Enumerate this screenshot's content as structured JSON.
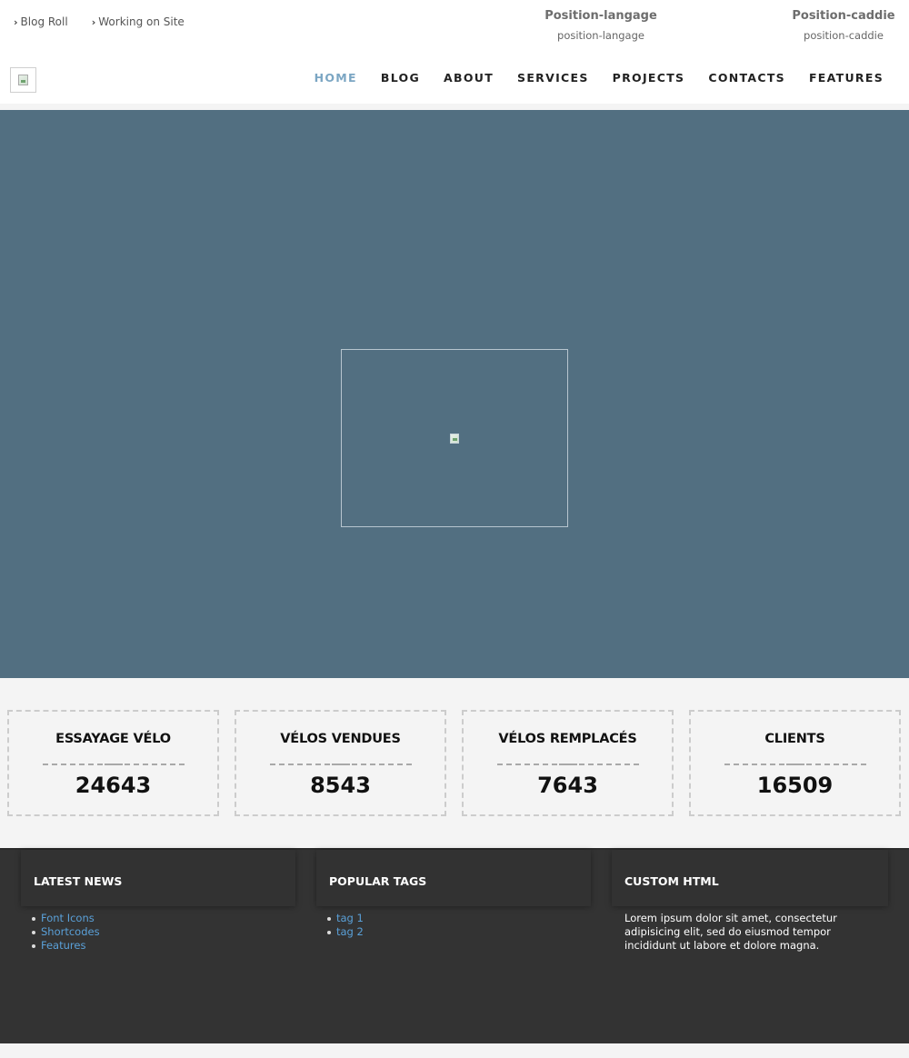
{
  "top_links": [
    {
      "label": "Blog Roll"
    },
    {
      "label": "Working on Site"
    }
  ],
  "position_langage": {
    "title": "Position-langage",
    "subtitle": "position-langage"
  },
  "position_caddie": {
    "title": "Position-caddie",
    "subtitle": "position-caddie"
  },
  "nav": {
    "items": [
      {
        "label": "HOME"
      },
      {
        "label": "BLOG"
      },
      {
        "label": "ABOUT"
      },
      {
        "label": "SERVICES"
      },
      {
        "label": "PROJECTS"
      },
      {
        "label": "CONTACTS"
      },
      {
        "label": "FEATURES"
      }
    ],
    "active_index": 0,
    "active_color": "#7ba6c3"
  },
  "hero": {
    "background_color": "#526f81"
  },
  "counters": [
    {
      "title": "ESSAYAGE VÉLO",
      "value": "24643"
    },
    {
      "title": "VÉLOS VENDUES",
      "value": "8543"
    },
    {
      "title": "VÉLOS REMPLACÉS",
      "value": "7643"
    },
    {
      "title": "CLIENTS",
      "value": "16509"
    }
  ],
  "footer": {
    "latest_news": {
      "title": "LATEST NEWS",
      "items": [
        {
          "label": "Font Icons"
        },
        {
          "label": "Shortcodes"
        },
        {
          "label": "Features"
        }
      ]
    },
    "popular_tags": {
      "title": "POPULAR TAGS",
      "items": [
        {
          "label": "tag 1"
        },
        {
          "label": "tag 2"
        }
      ]
    },
    "custom_html": {
      "title": "CUSTOM HTML",
      "text": "Lorem ipsum dolor sit amet, consectetur adipisicing elit, sed do eiusmod tempor incididunt ut labore et dolore magna."
    },
    "link_color": "#5aa0d8",
    "background_color": "#333333"
  }
}
